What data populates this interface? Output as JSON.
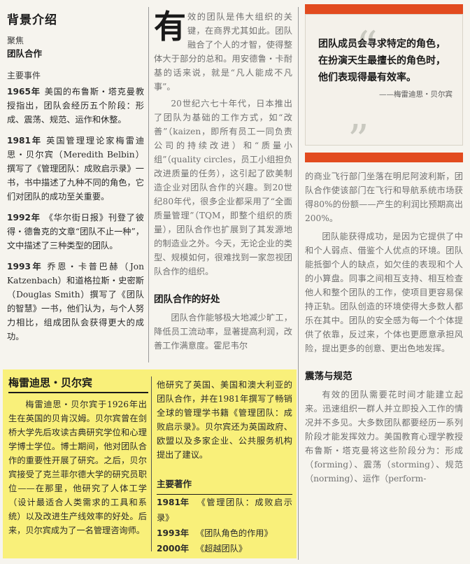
{
  "col1": {
    "section_title": "背景介绍",
    "focus_label": "聚焦",
    "focus_value": "团队合作",
    "events_label": "主要事件",
    "events": [
      {
        "year": "1965年",
        "text": "美国的布鲁斯・塔克曼教授指出，团队会经历五个阶段：形成、震荡、规范、运作和休整。"
      },
      {
        "year": "1981年",
        "text": "英国管理理论家梅雷迪思・贝尔宾（Meredith Belbin）撰写了《管理团队：成败启示录》一书，书中描述了九种不同的角色，它们对团队的成功至关重要。"
      },
      {
        "year": "1992年",
        "text": "《华尔街日报》刊登了彼得・德鲁克的文章“团队不止一种”，文中描述了三种类型的团队。"
      },
      {
        "year": "1993年",
        "text": "乔恩・卡普巴赫（Jon Katzenbach）和道格拉斯・史密斯（Douglas Smith）撰写了《团队的智慧》一书，他们认为，与个人努力相比，组成团队会获得更大的成功。"
      }
    ]
  },
  "col2": {
    "dropcap": "有",
    "para1": "效的团队是伟大组织的关键，在商界尤其如此。团队融合了个人的才智，使得整体大于部分的总和。用安德鲁・卡耐基的话来说，就是“凡人能成不凡事”。",
    "para2": "20世纪六七十年代，日本推出了团队为基础的工作方式，如“改善”（kaizen，即所有员工一同负责公司的持续改进）和“质量小组”（quality circles，员工小组担负改进质量的任务），这引起了欧美制造企业对团队合作的兴趣。到20世纪80年代，很多企业都采用了“全面质量管理”（TQM，即整个组织的质量），团队合作也扩展到了其发源地的制造业之外。今天，无论企业的类型、规模如何，很难找到一家忽视团队合作的组织。",
    "subtitle": "团队合作的好处",
    "para3": "团队合作能够极大地减少旷工，降低员工流动率，显著提高利润，改善工作满意度。霍尼韦尔"
  },
  "col3": {
    "quote": "团队成员会寻求特定的角色，在扮演天生最擅长的角色时，他们表现得最有效率。",
    "quote_source": "——梅雷迪思・贝尔宾",
    "para1": "的商业飞行部门坐落在明尼阿波利斯，团队合作使该部门在飞行和导航系统市场获得80%的份额——产生的利润比预期高出200%。",
    "para2": "团队能获得成功，是因为它提供了中和个人弱点、借鉴个人优点的环境。团队能抵御个人的缺点，如欠佳的表现和个人的小算盘。同事之间相互支持、相互检查他人和整个团队的工作，使项目更容易保持正轨。团队创造的环境使得大多数人都乐在其中。团队的安全感为每一个个体提供了依靠，反过来，个体也更愿意承担风险，提出更多的创意、更出色地发挥。",
    "subtitle": "震荡与规范",
    "para3": "有效的团队需要花时间才能建立起来。迅速组织一群人并立即投入工作的情况并不多见。大多数团队都要经历一系列阶段才能发挥效力。美国教育心理学教授布鲁斯・塔克曼将这些阶段分为：形成（forming）、震荡（storming）、规范（norming）、运作（perform-"
  },
  "ybox": {
    "title": "梅雷迪思・贝尔宾",
    "para1": "梅雷迪思・贝尔宾于1926年出生在英国的贝肯汉姆。贝尔宾曾在剑桥大学先后攻读古典研究学位和心理学博士学位。博士期间，他对团队合作的重要性开展了研究。之后，贝尔宾接受了克兰菲尔德大学的研究员职位——在那里，他研究了人体工学（设计最适合人类需求的工具和系统）以及改进生产线效率的好处。后来，贝尔宾成为了一名管理咨询师。",
    "para2": "他研究了英国、美国和澳大利亚的团队合作，并在1981年撰写了畅销全球的管理学书籍《管理团队：成败启示录》。贝尔宾还为英国政府、欧盟以及多家企业、公共服务机构提出了建议。",
    "works_title": "主要著作",
    "works": [
      {
        "year": "1981年",
        "title": "《管理团队：成败启示录》"
      },
      {
        "year": "1993年",
        "title": "《团队角色的作用》"
      },
      {
        "year": "2000年",
        "title": "《超越团队》"
      }
    ]
  },
  "colors": {
    "accent_red": "#e24b1f",
    "highlight_yellow": "#f9f07a"
  }
}
